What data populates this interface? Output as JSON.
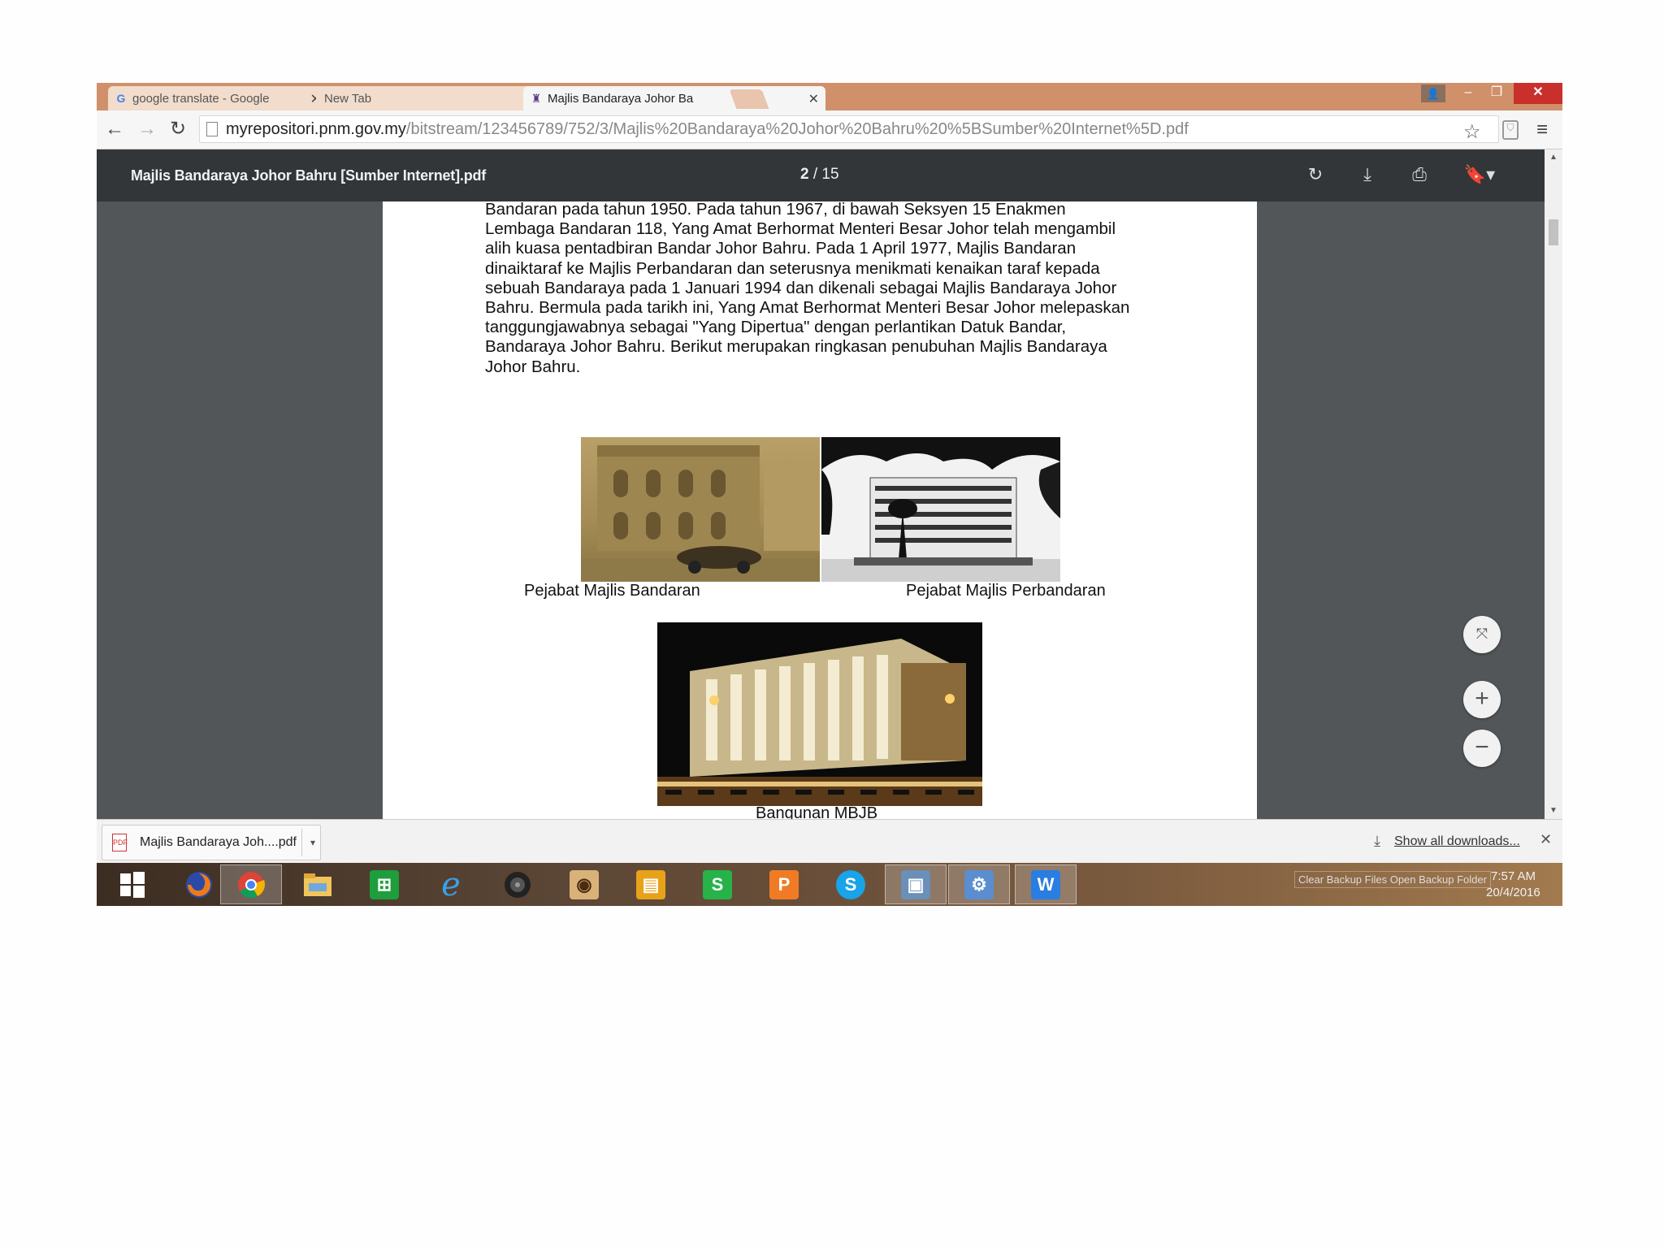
{
  "browser": {
    "tabs": [
      {
        "label": "google translate - Google",
        "icon": "google-icon"
      },
      {
        "label": "New Tab"
      },
      {
        "label": "Majlis Bandaraya Johor Ba",
        "icon": "mbjb-crest-icon"
      }
    ],
    "url_host": "myrepositori.pnm.gov.my",
    "url_path": "/bitstream/123456789/752/3/Majlis%20Bandaraya%20Johor%20Bahru%20%5BSumber%20Internet%5D.pdf"
  },
  "pdf": {
    "title": "Majlis Bandaraya Johor Bahru [Sumber Internet].pdf",
    "current_page": "2",
    "page_sep": "/",
    "total_pages": "15",
    "body_lines": [
      "Bandaran pada tahun 1950. Pada tahun 1967, di bawah Seksyen 15 Enakmen",
      "Lembaga Bandaran 118, Yang Amat Berhormat Menteri Besar Johor telah mengambil",
      "alih kuasa pentadbiran Bandar Johor Bahru. Pada 1 April 1977, Majlis Bandaran",
      "dinaiktaraf ke Majlis Perbandaran dan seterusnya menikmati kenaikan taraf kepada",
      "sebuah Bandaraya pada 1 Januari 1994 dan dikenali sebagai Majlis Bandaraya Johor",
      "Bahru. Bermula pada tarikh ini, Yang Amat Berhormat Menteri Besar Johor melepaskan",
      "tanggungjawabnya sebagai \"Yang Dipertua\" dengan perlantikan Datuk Bandar,",
      "Bandaraya Johor Bahru. Berikut merupakan ringkasan penubuhan Majlis Bandaraya",
      "Johor Bahru."
    ],
    "captions": {
      "photo1": "Pejabat Majlis Bandaran",
      "photo2": "Pejabat Majlis Perbandaran",
      "photo3": "Bangunan MBJB"
    }
  },
  "downloads": {
    "file_name": "Majlis Bandaraya Joh....pdf",
    "show_all": "Show all downloads..."
  },
  "taskbar": {
    "apps": [
      "windows-start-icon",
      "firefox-icon",
      "chrome-icon",
      "file-explorer-icon",
      "store-icon",
      "internet-explorer-icon",
      "media-player-icon",
      "camera-app-icon",
      "notes-app-icon",
      "spreadsheet-app-icon",
      "presentation-app-icon",
      "skype-icon",
      "photo-viewer-icon",
      "control-panel-icon",
      "writer-app-icon"
    ],
    "tray_tooltip": "Clear Backup Files  Open Backup Folder",
    "time": "7:57 AM",
    "date": "20/4/2016"
  }
}
